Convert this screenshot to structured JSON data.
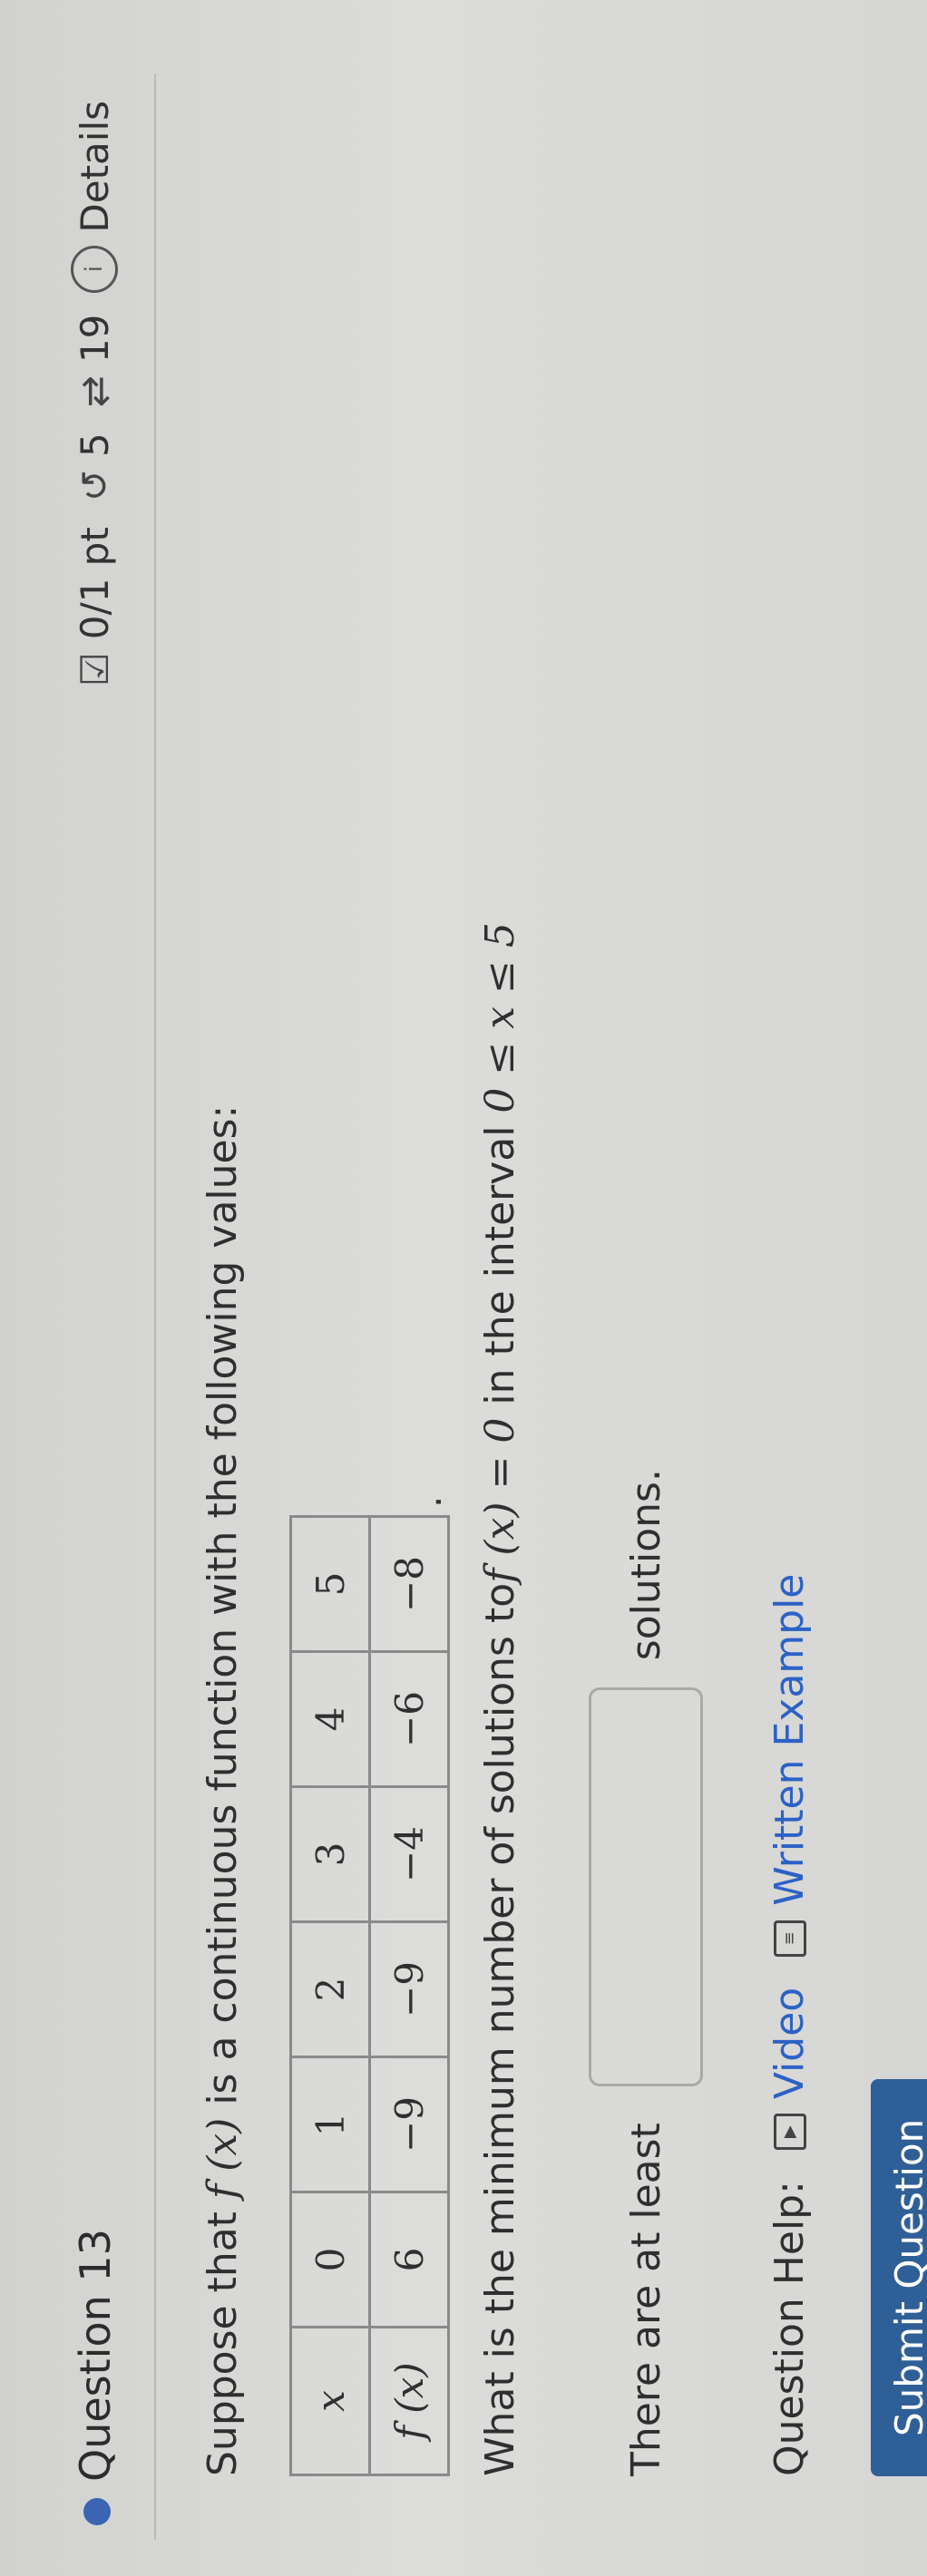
{
  "header": {
    "title": "Question 13",
    "score": "0/1 pt",
    "retries": "5",
    "attempts": "19",
    "details_label": "Details"
  },
  "prompt": {
    "lead": "Suppose that ",
    "fx": "f (x)",
    "tail": " is a continuous function with the following values:"
  },
  "table": {
    "x_header": "x",
    "fx_header": "f (x)",
    "x_values": [
      "0",
      "1",
      "2",
      "3",
      "4",
      "5"
    ],
    "fx_values": [
      "6",
      "−9",
      "−9",
      "−4",
      "−6",
      "−8"
    ],
    "trailing": "."
  },
  "question": {
    "lead": "What is the minimum number of solutions to",
    "equation": "f (x) = 0",
    "mid": " in the interval ",
    "interval": "0 ≤ x ≤ 5"
  },
  "answer": {
    "lead": "There are at least",
    "value": "",
    "tail": "solutions."
  },
  "help": {
    "label": "Question Help:",
    "video": "Video",
    "written": "Written Example"
  },
  "submit_label": "Submit Question"
}
